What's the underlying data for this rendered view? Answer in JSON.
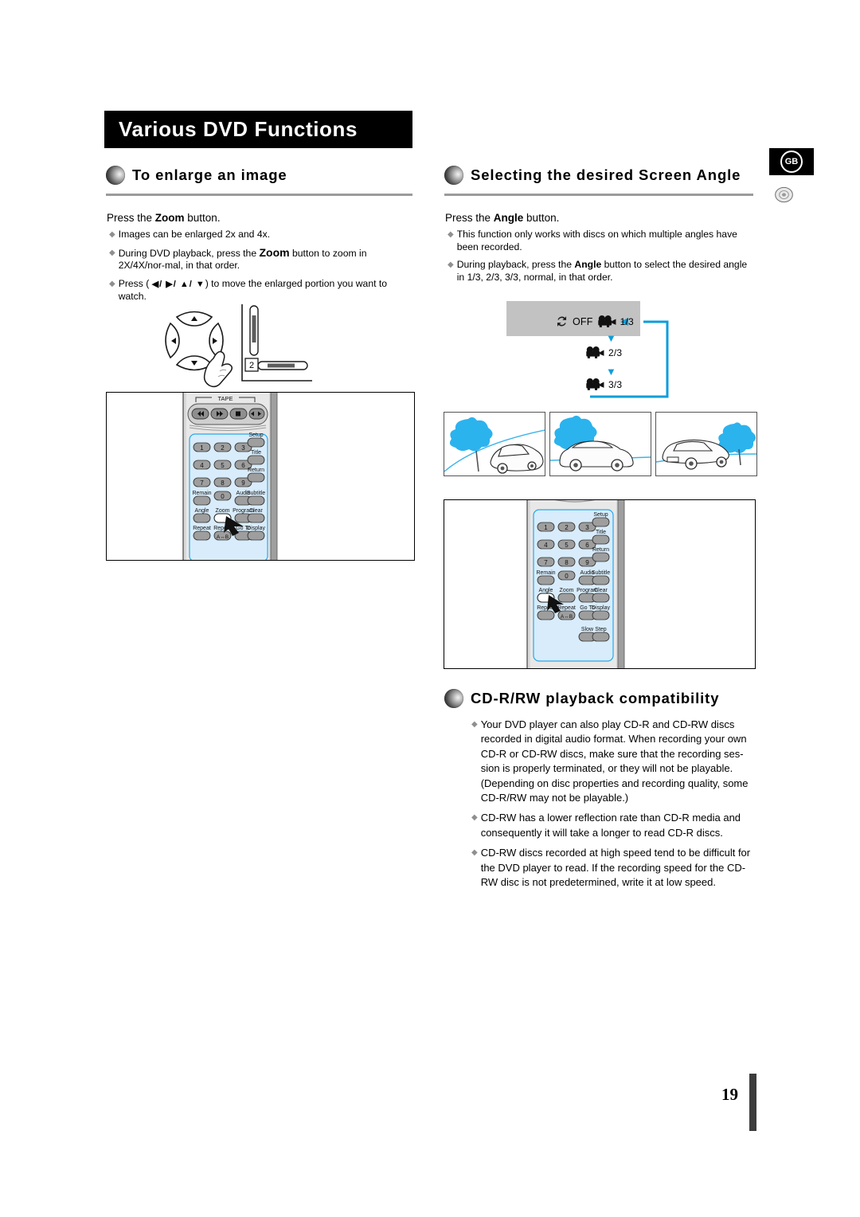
{
  "page": {
    "title": "Various DVD Functions",
    "number": "19",
    "region_badge": "GB"
  },
  "sections": [
    {
      "id": "enlarge",
      "icon": "sphere-bullet-icon",
      "title": "To enlarge an image",
      "lead_prefix": "Press the ",
      "lead_bold": "Zoom",
      "lead_suffix": " button.",
      "bullets": [
        {
          "text": "Images can be enlarged 2x and 4x."
        },
        {
          "pre": "During DVD playback, press the ",
          "bold": "Zoom",
          "post": " button to zoom in 2X/4X/nor-mal, in that order."
        },
        {
          "pre": "Press ( ",
          "arrows": "◀/ ▶/ ▲/ ▼",
          "post": ") to move the enlarged portion you want to watch."
        }
      ]
    },
    {
      "id": "screen-angle",
      "icon": "sphere-bullet-icon",
      "title": "Selecting the desired Screen Angle",
      "lead_prefix": "Press the ",
      "lead_bold": "Angle",
      "lead_suffix": " button.",
      "bullets": [
        {
          "text": "This function only works with discs on which multiple angles have been recorded."
        },
        {
          "pre": "During playback, press the ",
          "bold": "Angle",
          "post": " button to select the desired angle in 1/3, 2/3, 3/3, normal, in that order."
        }
      ]
    },
    {
      "id": "cdrw",
      "icon": "sphere-bullet-icon",
      "title": "CD-R/RW playback compatibility",
      "bullets": [
        {
          "text": "Your DVD player can also play CD-R and CD-RW discs recorded in digital audio format. When recording your own CD-R or CD-RW discs, make sure that the recording ses-sion is properly terminated, or they will not be playable. (Depending on disc properties and recording quality, some CD-R/RW may not be playable.)"
        },
        {
          "text": "CD-RW has a lower reflection rate than CD-R media and consequently it will take a longer to read CD-R discs."
        },
        {
          "text": "CD-RW discs recorded at high speed tend to be difficult for the DVD player to read. If the recording speed for the CD-RW disc is not predetermined, write it at low speed."
        }
      ]
    }
  ],
  "angle_diagram": {
    "off_label": "OFF",
    "steps": [
      "1/3",
      "2/3",
      "3/3"
    ],
    "loop_color": "#0d9ddb",
    "band_color": "#c2c2c2",
    "cycle_icon": "refresh-cycle-icon",
    "camera_icon": "movie-camera-icon"
  },
  "scenes": [
    {
      "caption": "angle-1-front-three-quarter"
    },
    {
      "caption": "angle-2-side"
    },
    {
      "caption": "angle-3-rear-three-quarter"
    }
  ],
  "remote_zoom": {
    "tape_label": "TAPE",
    "transport": [
      "rewind-icon",
      "fast-forward-icon",
      "stop-icon",
      "direction-icon"
    ],
    "highlight_button": "Zoom",
    "keys": [
      {
        "num": "1"
      },
      {
        "num": "2"
      },
      {
        "num": "3"
      },
      {
        "num": "4"
      },
      {
        "num": "5"
      },
      {
        "num": "6"
      },
      {
        "num": "7"
      },
      {
        "num": "8"
      },
      {
        "num": "9"
      },
      {
        "num": "0"
      }
    ],
    "labels": [
      "Setup",
      "Title",
      "Return",
      "Remain",
      "Audio",
      "Subtitle",
      "Angle",
      "Zoom",
      "Program",
      "Clear",
      "Repeat",
      "Repeat",
      "Go To",
      "Display",
      "A↔B"
    ]
  },
  "remote_angle": {
    "highlight_button": "Angle",
    "keys": [
      {
        "num": "1"
      },
      {
        "num": "2"
      },
      {
        "num": "3"
      },
      {
        "num": "4"
      },
      {
        "num": "5"
      },
      {
        "num": "6"
      },
      {
        "num": "7"
      },
      {
        "num": "8"
      },
      {
        "num": "9"
      },
      {
        "num": "0"
      }
    ],
    "labels": [
      "Setup",
      "Title",
      "Return",
      "Remain",
      "Audio",
      "Subtitle",
      "Angle",
      "Zoom",
      "Program",
      "Clear",
      "Repeat",
      "Repeat",
      "Go To",
      "Display",
      "Slow",
      "Step",
      "A↔B"
    ]
  },
  "zoom_illustration": {
    "step_badge": "2",
    "dpad_icon": "direction-pad-icon",
    "hand_icon": "hand-cursor-icon"
  }
}
